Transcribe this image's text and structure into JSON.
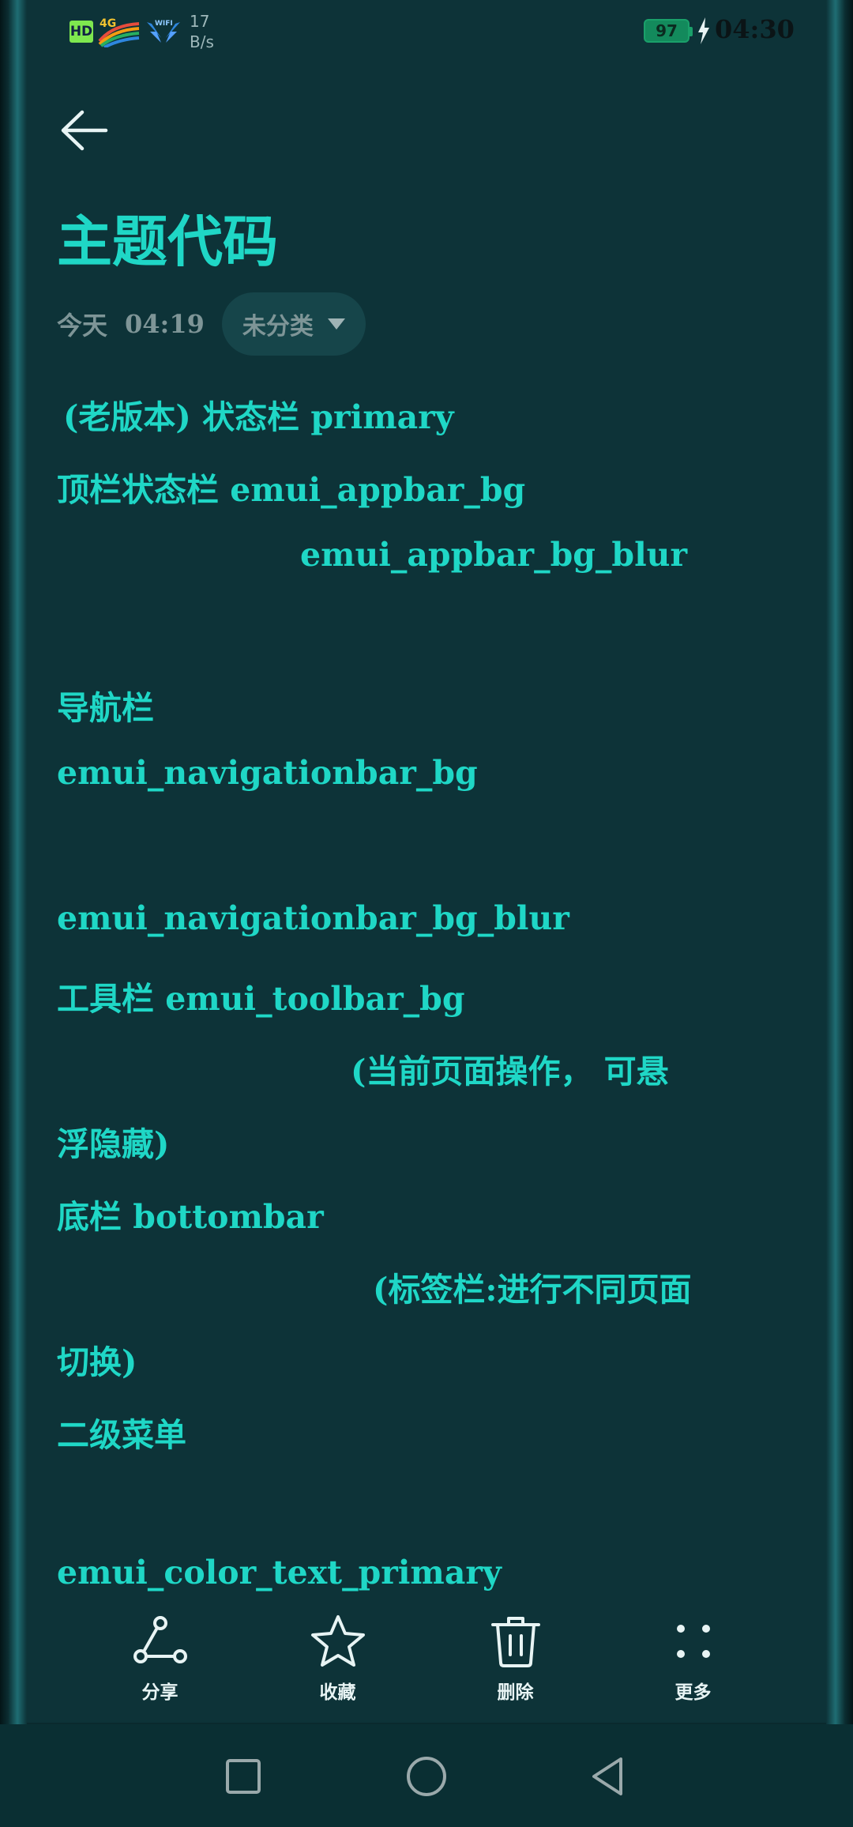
{
  "status_bar": {
    "hd": "HD",
    "net_type": "4G",
    "speed_value": "17",
    "speed_unit": "B/s",
    "battery": "97",
    "time": "04:30"
  },
  "header": {
    "title": "主题代码",
    "date_label": "今天",
    "date_time": "04:19",
    "category": "未分类"
  },
  "content_lines": [
    "(老版本) 状态栏       primary",
    "顶栏状态栏          emui_appbar_bg",
    "emui_appbar_bg_blur",
    "导航栏",
    "emui_navigationbar_bg",
    "emui_navigationbar_bg_blur",
    "工具栏            emui_toolbar_bg",
    "(当前页面操作，  可悬",
    "浮隐藏)",
    "底栏               bottombar",
    "(标签栏:进行不同页面",
    "切换)",
    "二级菜单",
    "emui_color_text_primary"
  ],
  "toolbar": {
    "share": "分享",
    "favorite": "收藏",
    "delete": "删除",
    "more": "更多"
  },
  "icons": {
    "back": "arrow-left-icon",
    "share": "share-icon",
    "favorite": "star-icon",
    "delete": "trash-icon",
    "more": "more-dots-icon",
    "nav_recent": "square-icon",
    "nav_home": "circle-icon",
    "nav_back": "triangle-back-icon"
  },
  "colors": {
    "background": "#0d3338",
    "accent_text": "#1fd7c6",
    "muted_text": "#7e9597"
  }
}
